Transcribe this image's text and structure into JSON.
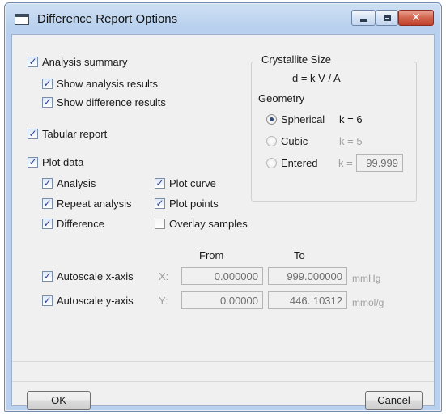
{
  "window": {
    "title": "Difference Report Options"
  },
  "options": {
    "analysis_summary": {
      "label": "Analysis summary",
      "checked": true
    },
    "show_analysis_results": {
      "label": "Show analysis results",
      "checked": true
    },
    "show_difference_results": {
      "label": "Show difference results",
      "checked": true
    },
    "tabular_report": {
      "label": "Tabular report",
      "checked": true
    },
    "plot_data": {
      "label": "Plot data",
      "checked": true
    },
    "analysis": {
      "label": "Analysis",
      "checked": true
    },
    "repeat_analysis": {
      "label": "Repeat analysis",
      "checked": true
    },
    "difference": {
      "label": "Difference",
      "checked": true
    },
    "plot_curve": {
      "label": "Plot curve",
      "checked": true
    },
    "plot_points": {
      "label": "Plot points",
      "checked": true
    },
    "overlay_samples": {
      "label": "Overlay samples",
      "checked": false
    }
  },
  "crystallite": {
    "title": "Crystallite Size",
    "formula": "d = k V / A",
    "geometry_label": "Geometry",
    "spherical": {
      "label": "Spherical",
      "k_text": "k = 6",
      "selected": true
    },
    "cubic": {
      "label": "Cubic",
      "k_text": "k = 5",
      "selected": false
    },
    "entered": {
      "label": "Entered",
      "k_label": "k =",
      "k_value": "99.999",
      "selected": false
    }
  },
  "autoscale": {
    "from_header": "From",
    "to_header": "To",
    "x_axis": {
      "label": "Autoscale x-axis",
      "checked": true,
      "axis_label": "X:",
      "from": "0.000000",
      "to": "999.000000",
      "unit": "mmHg"
    },
    "y_axis": {
      "label": "Autoscale y-axis",
      "checked": true,
      "axis_label": "Y:",
      "from": "0.00000",
      "to": "446. 10312",
      "unit": "mmol/g"
    }
  },
  "buttons": {
    "ok": "OK",
    "cancel": "Cancel"
  },
  "colors": {
    "window_frame": "#b9d1ee",
    "close_button": "#c0412b",
    "check_mark": "#2b3f8f"
  }
}
